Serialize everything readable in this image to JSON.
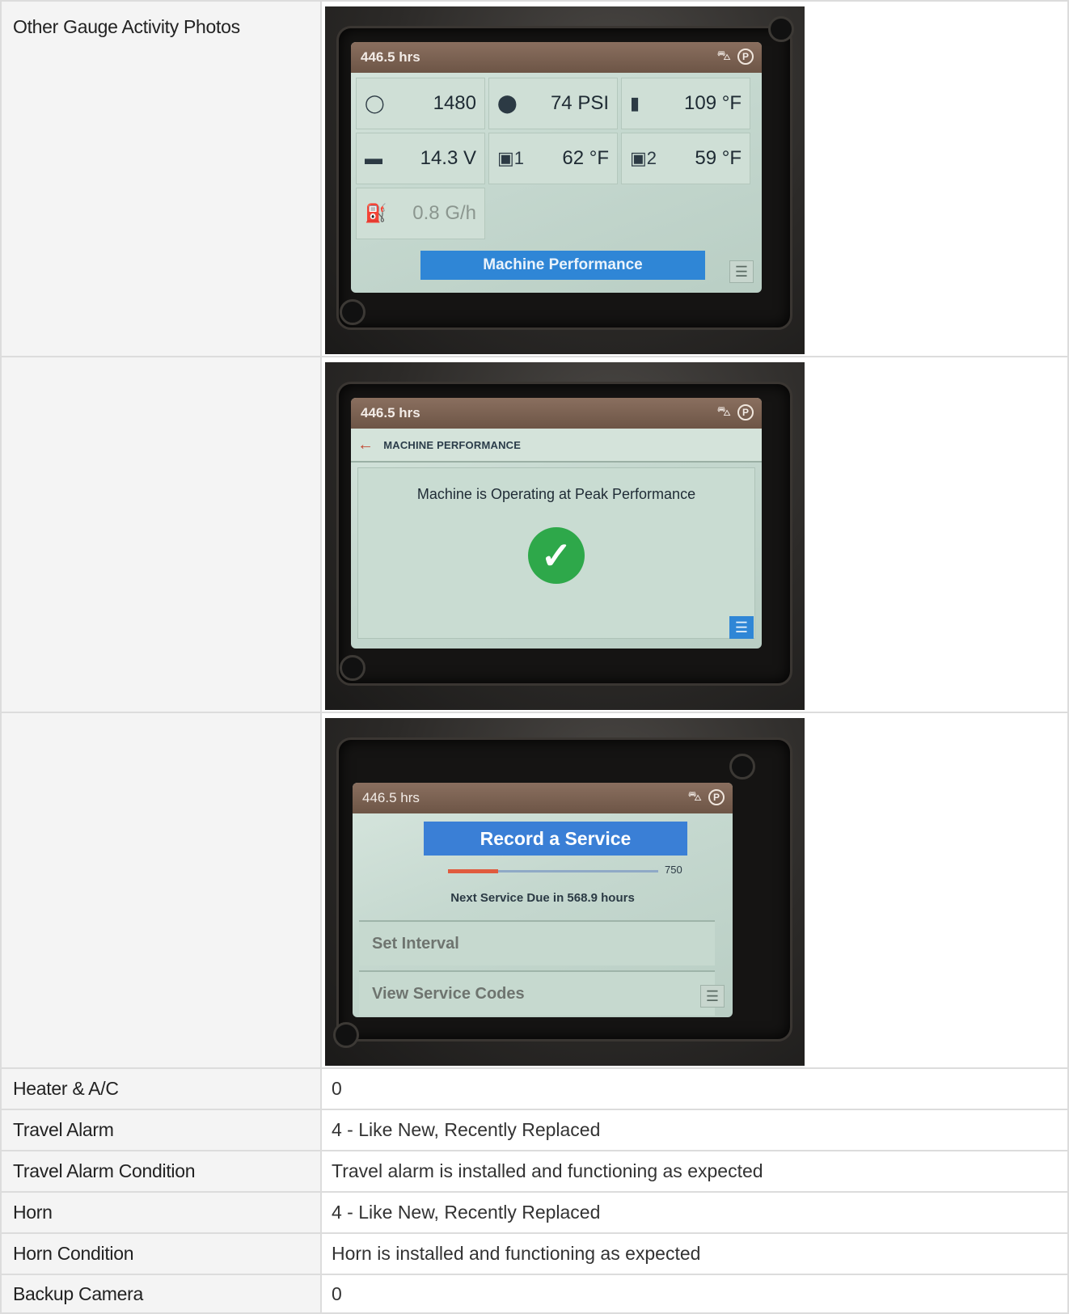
{
  "rows": {
    "gauge_photos": {
      "label": "Other Gauge Activity Photos"
    },
    "heater": {
      "label": "Heater & A/C",
      "value": "0"
    },
    "travel_alarm": {
      "label": "Travel Alarm",
      "value": "4 - Like New, Recently Replaced"
    },
    "travel_alarm_condition": {
      "label": "Travel Alarm Condition",
      "value": "Travel alarm is installed and functioning as expected"
    },
    "horn": {
      "label": "Horn",
      "value": "4 - Like New, Recently Replaced"
    },
    "horn_condition": {
      "label": "Horn Condition",
      "value": "Horn is installed and functioning as expected"
    },
    "backup_camera": {
      "label": "Backup Camera",
      "value": "0"
    }
  },
  "photos": [
    {
      "hours": "446.5 hrs",
      "status_icons": [
        "hydraulic-lock-icon",
        "parking-brake-icon"
      ],
      "parking_label": "P",
      "gauges": [
        {
          "icon": "engine-speed-icon",
          "glyph": "◯",
          "value": "1480"
        },
        {
          "icon": "oil-pressure-icon",
          "glyph": "⬤",
          "value": "74 PSI"
        },
        {
          "icon": "coolant-temp-icon",
          "glyph": "🌡",
          "value": "109 °F"
        },
        {
          "icon": "battery-icon",
          "glyph": "▬",
          "value": "14.3 V"
        },
        {
          "icon": "hydraulic-temp-1-icon",
          "glyph": "▣1",
          "value": "62 °F"
        },
        {
          "icon": "hydraulic-temp-2-icon",
          "glyph": "▣2",
          "value": "59 °F"
        },
        {
          "icon": "fuel-rate-icon",
          "glyph": "⛽",
          "value": "0.8 G/h"
        }
      ],
      "button": "Machine Performance"
    },
    {
      "hours": "446.5 hrs",
      "header": "MACHINE PERFORMANCE",
      "message": "Machine is Operating at Peak Performance"
    },
    {
      "hours": "446.5 hrs",
      "title": "Record a Service",
      "max": "750",
      "progress": 0.24,
      "next_due": "Next Service Due in 568.9 hours",
      "items": [
        "Set Interval",
        "View Service Codes"
      ]
    }
  ],
  "colors": {
    "accent_blue": "#2f86d6",
    "ok_green": "#2ea84a",
    "warn_red": "#e05b3e"
  }
}
